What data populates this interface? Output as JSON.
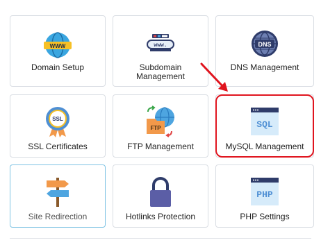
{
  "tiles": [
    {
      "label": "Domain Setup",
      "icon": "www-globe-icon"
    },
    {
      "label": "Subdomain Management",
      "icon": "subdomain-www-icon"
    },
    {
      "label": "DNS Management",
      "icon": "dns-globe-icon"
    },
    {
      "label": "SSL Certificates",
      "icon": "ssl-badge-icon"
    },
    {
      "label": "FTP Management",
      "icon": "ftp-folder-icon"
    },
    {
      "label": "MySQL Management",
      "icon": "sql-window-icon"
    },
    {
      "label": "Site Redirection",
      "icon": "signpost-icon"
    },
    {
      "label": "Hotlinks Protection",
      "icon": "padlock-icon"
    },
    {
      "label": "PHP Settings",
      "icon": "php-window-icon"
    }
  ],
  "icon_text": {
    "www": "WWW",
    "subdomain": "www.",
    "dns": "DNS",
    "ssl": "SSL",
    "ftp": "FTP",
    "sql": "SQL",
    "php": "PHP"
  },
  "colors": {
    "highlight": "#e0141e",
    "selected_border": "#7ec3e3",
    "tile_border": "#d9dde3"
  }
}
